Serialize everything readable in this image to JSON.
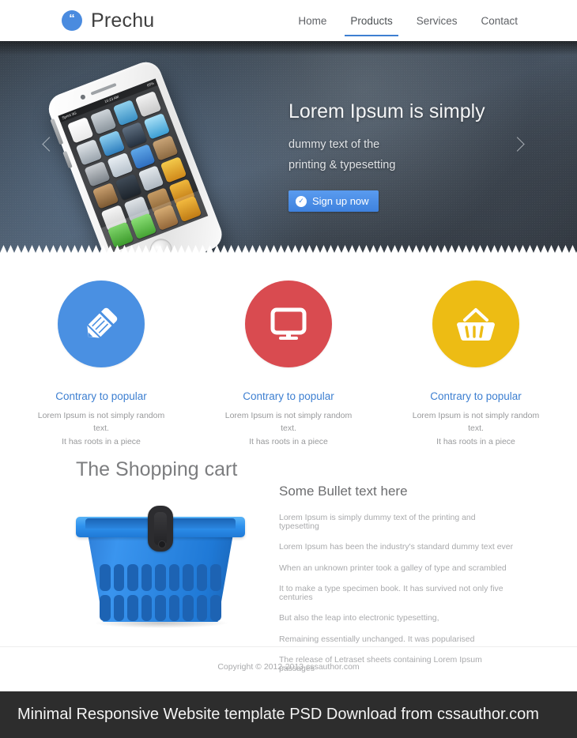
{
  "header": {
    "brand_mark": "quote-icon",
    "brand_name": "Prechu",
    "nav": [
      {
        "label": "Home",
        "active": false
      },
      {
        "label": "Products",
        "active": true
      },
      {
        "label": "Services",
        "active": false
      },
      {
        "label": "Contact",
        "active": false
      }
    ]
  },
  "hero": {
    "title": "Lorem Ipsum is simply",
    "sub_line_1": "dummy text of the",
    "sub_line_2": "printing & typesetting",
    "cta_label": "Sign up now",
    "cta_icon": "check-circle-icon",
    "prev_arrow": "chevron-left-icon",
    "next_arrow": "chevron-right-icon",
    "status_left": "Sprint 3G",
    "status_center": "10:23 AM",
    "status_right": "65%",
    "accent": "#3f82de",
    "background": "#3c4753"
  },
  "features": [
    {
      "icon": "pencil-icon",
      "color": "#4a90e2",
      "title": "Contrary to popular",
      "text_line_1": "Lorem Ipsum is not simply random text.",
      "text_line_2": "It has roots in a piece"
    },
    {
      "icon": "monitor-icon",
      "color": "#d94b50",
      "title": "Contrary to popular",
      "text_line_1": "Lorem Ipsum is not simply random text.",
      "text_line_2": "It has roots in a piece"
    },
    {
      "icon": "basket-icon",
      "color": "#edbc14",
      "title": "Contrary to popular",
      "text_line_1": "Lorem Ipsum is not simply random text.",
      "text_line_2": "It has roots in a piece"
    }
  ],
  "cart_section": {
    "heading": "The Shopping cart",
    "illustration": "shopping-basket-illustration",
    "bullets_title": "Some Bullet text here",
    "bullets": [
      "Lorem Ipsum is simply dummy text of the printing and typesetting",
      "Lorem Ipsum has been the industry's standard dummy text ever",
      "When an unknown printer took a galley of type and scrambled",
      "It to make a type specimen book. It has survived not only five centuries",
      "But also the leap into electronic typesetting,",
      "Remaining essentially unchanged. It was popularised",
      "The release of Letraset sheets containing Lorem Ipsum passages"
    ]
  },
  "footer": {
    "copyright": "Copyright © 2012-2013 cssauthor.com",
    "promo": "Minimal Responsive Website template PSD Download from cssauthor.com"
  }
}
